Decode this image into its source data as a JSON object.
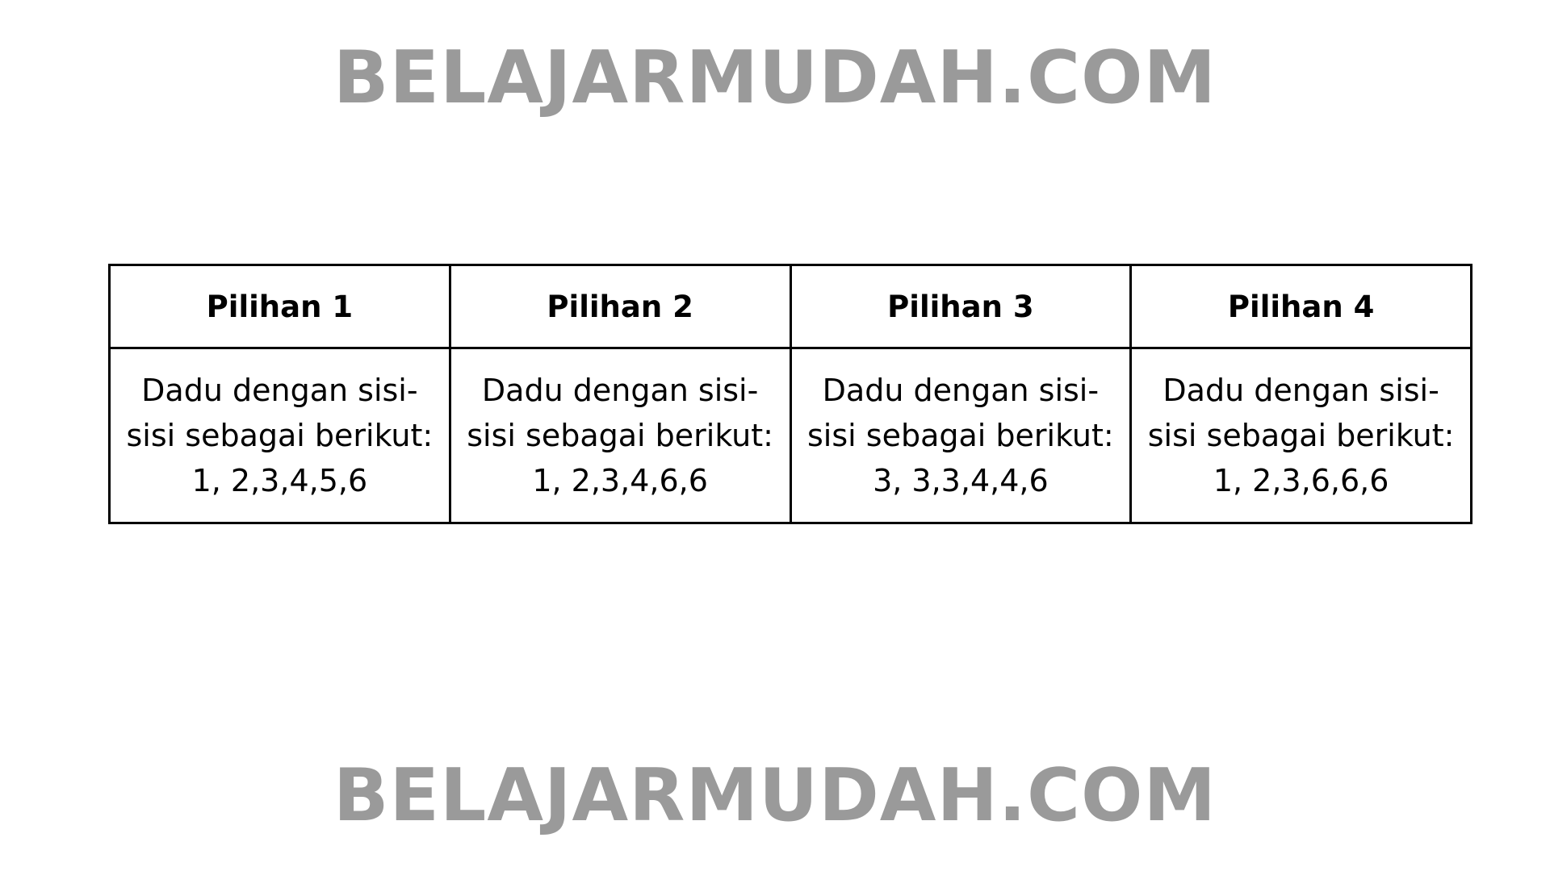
{
  "watermark": {
    "top": "BELAJARMUDAH.COM",
    "bottom": "BELAJARMUDAH.COM",
    "color": "#9a9a9a"
  },
  "table": {
    "headers": [
      "Pilihan 1",
      "Pilihan 2",
      "Pilihan 3",
      "Pilihan 4"
    ],
    "cells": [
      {
        "line1": "Dadu dengan sisi-",
        "line2": "sisi sebagai berikut:",
        "line3": "1, 2,3,4,5,6"
      },
      {
        "line1": "Dadu dengan sisi-",
        "line2": "sisi sebagai berikut:",
        "line3": "1, 2,3,4,6,6"
      },
      {
        "line1": "Dadu dengan sisi-",
        "line2": "sisi sebagai berikut:",
        "line3": "3, 3,3,4,4,6"
      },
      {
        "line1": "Dadu dengan sisi-",
        "line2": "sisi sebagai berikut:",
        "line3": "1, 2,3,6,6,6"
      }
    ]
  }
}
